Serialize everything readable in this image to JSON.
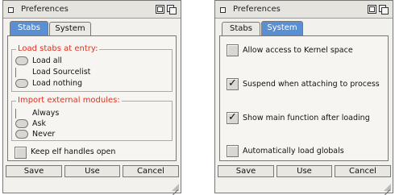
{
  "windows": {
    "left": {
      "title": "Preferences",
      "tabs": [
        "Stabs",
        "System"
      ],
      "active_tab": "Stabs",
      "load_group": {
        "label": "Load stabs at entry:",
        "options": [
          "Load all",
          "Load Sourcelist",
          "Load nothing"
        ]
      },
      "import_group": {
        "label": "Import external modules:",
        "options": [
          "Always",
          "Ask",
          "Never"
        ]
      },
      "keep_elf": {
        "label": "Keep elf handles open",
        "checked": false
      },
      "buttons": [
        "Save",
        "Use",
        "Cancel"
      ]
    },
    "right": {
      "title": "Preferences",
      "tabs": [
        "Stabs",
        "System"
      ],
      "active_tab": "System",
      "options": [
        {
          "label": "Allow access to Kernel space",
          "checked": false
        },
        {
          "label": "Suspend when attaching to process",
          "checked": true
        },
        {
          "label": "Show main function after loading",
          "checked": true
        },
        {
          "label": "Automatically load globals",
          "checked": false
        }
      ],
      "buttons": [
        "Save",
        "Use",
        "Cancel"
      ]
    }
  },
  "icons": {
    "close": "close-box-icon",
    "zoom": "zoom-gadget-icon",
    "depth": "depth-gadget-icon",
    "resize": "resize-grip-icon"
  },
  "colors": {
    "active_tab": "#5a8fd3",
    "group_label": "#e03020",
    "window_bg": "#f2f1ed"
  }
}
